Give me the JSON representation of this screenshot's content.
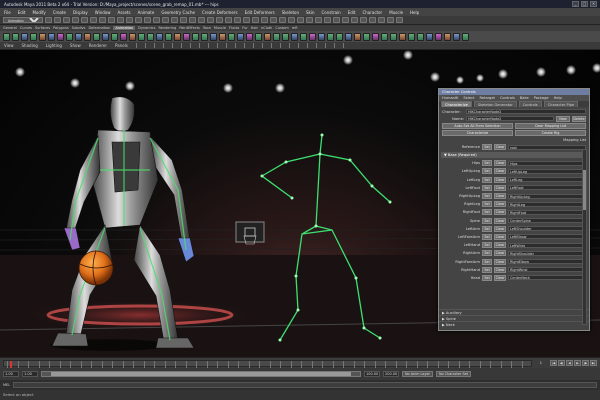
{
  "app": {
    "title": "Autodesk Maya 2011 Beta 2 x64 - Trial Version: D:/Maya_project/scenes/scene_grab_remap_01.mb* --- hips",
    "window_controls": [
      "_",
      "□",
      "×"
    ]
  },
  "menu_bar": [
    "File",
    "Edit",
    "Modify",
    "Create",
    "Display",
    "Window",
    "Assets",
    "Animate",
    "Geometry Cache",
    "Create Deformers",
    "Edit Deformers",
    "Skeleton",
    "Skin",
    "Constrain",
    "Edit",
    "Character",
    "Muscle",
    "Help"
  ],
  "status_line": {
    "mode_select": "Animation"
  },
  "shelf_tabs": {
    "items": [
      "General",
      "Curves",
      "Surfaces",
      "Polygons",
      "Subdivs",
      "Deformation",
      "Animation",
      "Dynamics",
      "Rendering",
      "PaintEffects",
      "Toon",
      "Muscle",
      "Fluids",
      "Fur",
      "Hair",
      "nCloth",
      "Custom",
      "mR"
    ],
    "active_index": 6
  },
  "panel_menu": [
    "View",
    "Shading",
    "Lighting",
    "Show",
    "Renderer",
    "Panels"
  ],
  "character_controls": {
    "title": "Character Controls",
    "menu": [
      "HumanIK",
      "Select",
      "Retarget",
      "Controls",
      "Bake",
      "Package",
      "Help"
    ],
    "tabs": [
      {
        "label": "Characterize"
      },
      {
        "label": "Skeleton Generator"
      },
      {
        "label": "Controls"
      },
      {
        "label": "Character Pipe"
      }
    ],
    "character_label": "Character:",
    "character_value": "HIKCharacterNode2",
    "name_label": "Name:",
    "name_value": "HIKCharacterNode2",
    "new_btn": "New",
    "delete_btn": "Delete",
    "auto_set_btn": "Auto-Set All From Selection",
    "clear_map_btn": "Clear Mapping List",
    "characterize_btn": "Characterize",
    "create_rig_btn": "Create Rig",
    "mapping_list_label": "Mapping List",
    "reference_label": "Reference",
    "base_header": "Base (Required)",
    "sel_btn": "Sel",
    "clear_btn": "Clear",
    "reference_value": "root",
    "mappings": [
      {
        "label": "Hips",
        "value": "Hips"
      },
      {
        "label": "LeftUpLeg",
        "value": "LeftUpLeg"
      },
      {
        "label": "LeftLeg",
        "value": "LeftLeg"
      },
      {
        "label": "LeftFoot",
        "value": "LeftFoot"
      },
      {
        "label": "RightUpLeg",
        "value": "RightUpLeg"
      },
      {
        "label": "RightLeg",
        "value": "RightLeg"
      },
      {
        "label": "RightFoot",
        "value": "RightFoot"
      },
      {
        "label": "Spine",
        "value": "CenterSpine"
      },
      {
        "label": "LeftArm",
        "value": "LeftShoulder"
      },
      {
        "label": "LeftForeArm",
        "value": "LeftElbow"
      },
      {
        "label": "LeftHand",
        "value": "LeftWrist"
      },
      {
        "label": "RightArm",
        "value": "RightShoulder"
      },
      {
        "label": "RightForeArm",
        "value": "RightElbow"
      },
      {
        "label": "RightHand",
        "value": "RightWrist"
      },
      {
        "label": "Head",
        "value": "CenterNeck"
      }
    ],
    "folds": [
      "Auxiliary",
      "Spine",
      "Neck"
    ]
  },
  "time_slider": {
    "current_frame": "1"
  },
  "range_slider": {
    "start": "1.00",
    "inner_start": "1.00",
    "inner_end": "100.00",
    "end": "200.00",
    "anim_layer": "No Anim Layer",
    "character_set": "No Character Set"
  },
  "command_line": {
    "label": "MEL"
  },
  "help_line": {
    "text": "Select an object"
  }
}
